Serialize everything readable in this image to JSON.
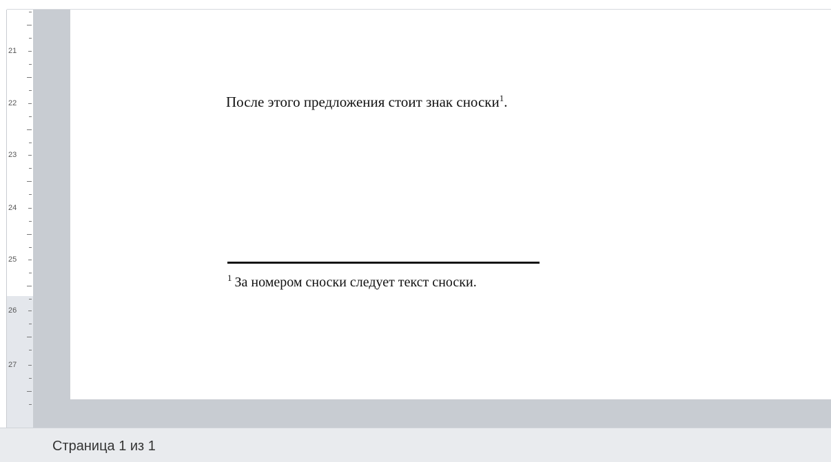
{
  "ruler": {
    "marks": [
      "21",
      "22",
      "23",
      "24",
      "25",
      "26",
      "27"
    ]
  },
  "document": {
    "sentence": "После этого предложения стоит знак сноски",
    "sentence_end": ".",
    "footnote_ref": "1",
    "footnote_number": "1",
    "footnote_text": "За номером сноски следует текст сноски."
  },
  "status_bar": {
    "page_indicator": "Страница 1 из 1"
  }
}
